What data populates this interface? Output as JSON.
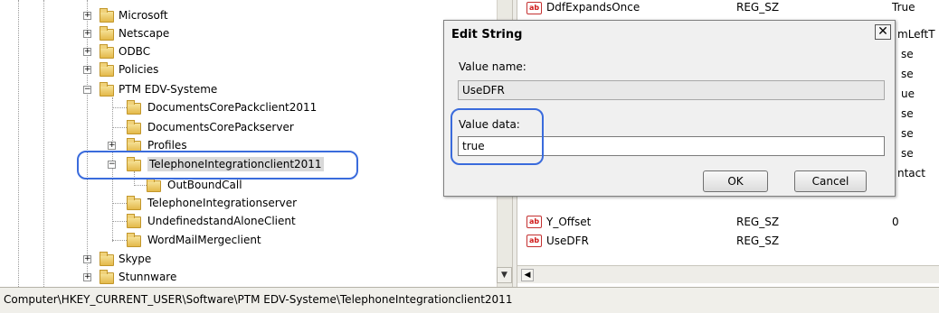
{
  "tree": {
    "nodes": [
      {
        "label": "Microsoft",
        "expander": "+"
      },
      {
        "label": "Netscape",
        "expander": "+"
      },
      {
        "label": "ODBC",
        "expander": "+"
      },
      {
        "label": "Policies",
        "expander": "+"
      },
      {
        "label": "PTM EDV-Systeme",
        "expander": "−"
      },
      {
        "label": "DocumentsCorePackclient2011",
        "expander": ""
      },
      {
        "label": "DocumentsCorePackserver",
        "expander": ""
      },
      {
        "label": "Profiles",
        "expander": "+"
      },
      {
        "label": "TelephoneIntegrationclient2011",
        "expander": "−"
      },
      {
        "label": "OutBoundCall",
        "expander": ""
      },
      {
        "label": "TelephoneIntegrationserver",
        "expander": ""
      },
      {
        "label": "UndefinedstandAloneClient",
        "expander": ""
      },
      {
        "label": "WordMailMergeclient",
        "expander": ""
      },
      {
        "label": "Skype",
        "expander": "+"
      },
      {
        "label": "Stunnware",
        "expander": "+"
      }
    ]
  },
  "values": {
    "top_row": {
      "name": "DdfExpandsOnce",
      "type": "REG_SZ",
      "data": "True"
    },
    "right_edge_data": [
      "mLeftT",
      "se",
      "se",
      "ue",
      "se",
      "se",
      "se",
      "ntact"
    ],
    "rows": [
      {
        "name": "Y_Offset",
        "type": "REG_SZ",
        "data": "0",
        "icon": "ab"
      },
      {
        "name": "UseDFR",
        "type": "REG_SZ",
        "data": "",
        "icon": "ab"
      }
    ]
  },
  "dialog": {
    "title": "Edit String",
    "close_glyph": "✕",
    "value_name_label": "Value name:",
    "value_name": "UseDFR",
    "value_data_label": "Value data:",
    "value_data": "true",
    "ok_label": "OK",
    "cancel_label": "Cancel"
  },
  "status_bar": {
    "path": "Computer\\HKEY_CURRENT_USER\\Software\\PTM EDV-Systeme\\TelephoneIntegrationclient2011"
  },
  "colors": {
    "annotation_ring": "#3a6bdc",
    "folder": "#e8c35a",
    "reg_icon": "#d01818"
  }
}
